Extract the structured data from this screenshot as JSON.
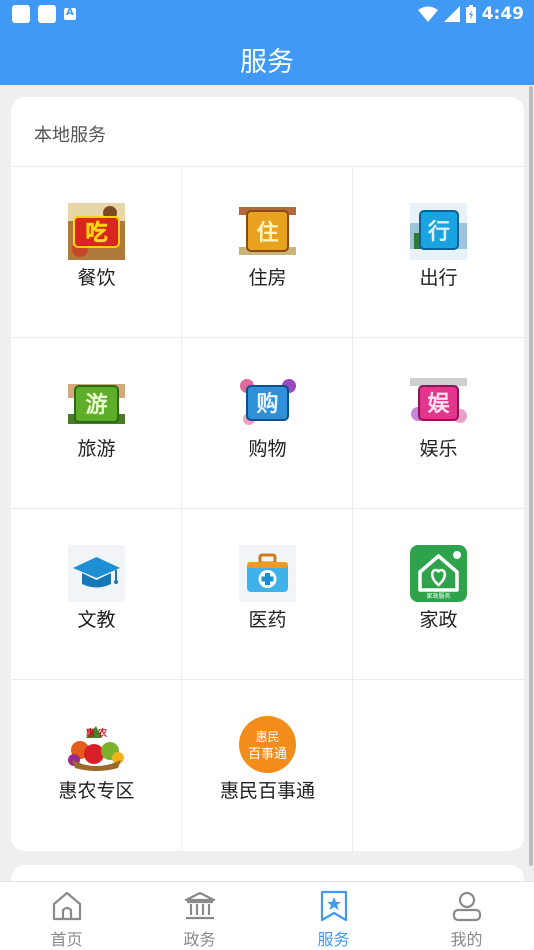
{
  "status_bar": {
    "time": "4:49"
  },
  "header": {
    "title": "服务"
  },
  "section": {
    "title": "本地服务",
    "items": [
      {
        "label": "餐饮",
        "icon": "dining-icon",
        "glyph": "吃"
      },
      {
        "label": "住房",
        "icon": "housing-icon",
        "glyph": "住"
      },
      {
        "label": "出行",
        "icon": "travel-icon",
        "glyph": "行"
      },
      {
        "label": "旅游",
        "icon": "tourism-icon",
        "glyph": "游"
      },
      {
        "label": "购物",
        "icon": "shopping-icon",
        "glyph": "购"
      },
      {
        "label": "娱乐",
        "icon": "entertainment-icon",
        "glyph": "娱"
      },
      {
        "label": "文教",
        "icon": "graduation-cap-icon"
      },
      {
        "label": "医药",
        "icon": "medical-kit-icon"
      },
      {
        "label": "家政",
        "icon": "home-heart-icon",
        "sublabel": "家政服务"
      },
      {
        "label": "惠农专区",
        "icon": "produce-basket-icon",
        "glyph": "惠 农"
      },
      {
        "label": "惠民百事通",
        "icon": "huimin-badge-icon",
        "badge_line1": "惠民",
        "badge_line2": "百事通"
      }
    ]
  },
  "bottom_nav": [
    {
      "label": "首页",
      "icon": "home-icon",
      "active": false
    },
    {
      "label": "政务",
      "icon": "government-building-icon",
      "active": false
    },
    {
      "label": "服务",
      "icon": "bookmark-star-icon",
      "active": true
    },
    {
      "label": "我的",
      "icon": "user-icon",
      "active": false
    }
  ],
  "colors": {
    "accent": "#3f99f5",
    "inactive": "#8a8a8a"
  }
}
